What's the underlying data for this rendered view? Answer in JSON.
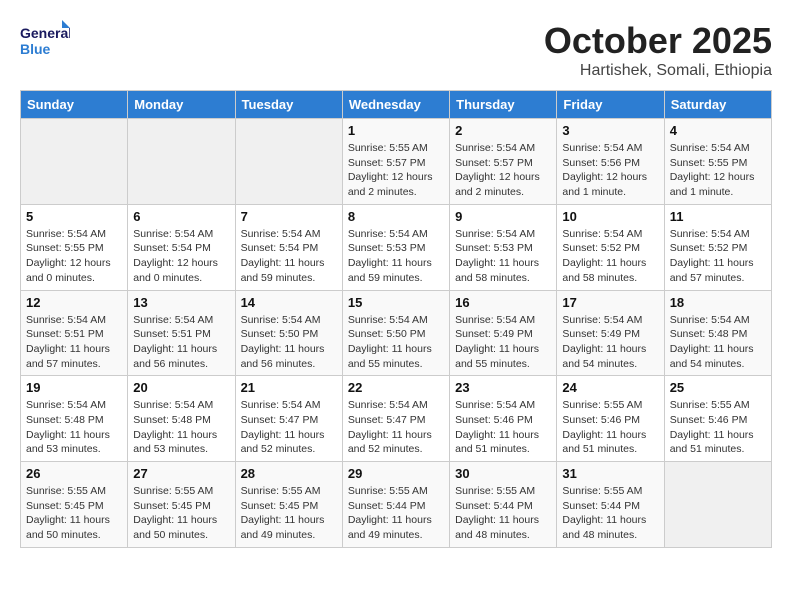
{
  "header": {
    "logo_line1": "General",
    "logo_line2": "Blue",
    "month": "October 2025",
    "location": "Hartishek, Somali, Ethiopia"
  },
  "weekdays": [
    "Sunday",
    "Monday",
    "Tuesday",
    "Wednesday",
    "Thursday",
    "Friday",
    "Saturday"
  ],
  "weeks": [
    [
      {
        "day": "",
        "info": ""
      },
      {
        "day": "",
        "info": ""
      },
      {
        "day": "",
        "info": ""
      },
      {
        "day": "1",
        "info": "Sunrise: 5:55 AM\nSunset: 5:57 PM\nDaylight: 12 hours\nand 2 minutes."
      },
      {
        "day": "2",
        "info": "Sunrise: 5:54 AM\nSunset: 5:57 PM\nDaylight: 12 hours\nand 2 minutes."
      },
      {
        "day": "3",
        "info": "Sunrise: 5:54 AM\nSunset: 5:56 PM\nDaylight: 12 hours\nand 1 minute."
      },
      {
        "day": "4",
        "info": "Sunrise: 5:54 AM\nSunset: 5:55 PM\nDaylight: 12 hours\nand 1 minute."
      }
    ],
    [
      {
        "day": "5",
        "info": "Sunrise: 5:54 AM\nSunset: 5:55 PM\nDaylight: 12 hours\nand 0 minutes."
      },
      {
        "day": "6",
        "info": "Sunrise: 5:54 AM\nSunset: 5:54 PM\nDaylight: 12 hours\nand 0 minutes."
      },
      {
        "day": "7",
        "info": "Sunrise: 5:54 AM\nSunset: 5:54 PM\nDaylight: 11 hours\nand 59 minutes."
      },
      {
        "day": "8",
        "info": "Sunrise: 5:54 AM\nSunset: 5:53 PM\nDaylight: 11 hours\nand 59 minutes."
      },
      {
        "day": "9",
        "info": "Sunrise: 5:54 AM\nSunset: 5:53 PM\nDaylight: 11 hours\nand 58 minutes."
      },
      {
        "day": "10",
        "info": "Sunrise: 5:54 AM\nSunset: 5:52 PM\nDaylight: 11 hours\nand 58 minutes."
      },
      {
        "day": "11",
        "info": "Sunrise: 5:54 AM\nSunset: 5:52 PM\nDaylight: 11 hours\nand 57 minutes."
      }
    ],
    [
      {
        "day": "12",
        "info": "Sunrise: 5:54 AM\nSunset: 5:51 PM\nDaylight: 11 hours\nand 57 minutes."
      },
      {
        "day": "13",
        "info": "Sunrise: 5:54 AM\nSunset: 5:51 PM\nDaylight: 11 hours\nand 56 minutes."
      },
      {
        "day": "14",
        "info": "Sunrise: 5:54 AM\nSunset: 5:50 PM\nDaylight: 11 hours\nand 56 minutes."
      },
      {
        "day": "15",
        "info": "Sunrise: 5:54 AM\nSunset: 5:50 PM\nDaylight: 11 hours\nand 55 minutes."
      },
      {
        "day": "16",
        "info": "Sunrise: 5:54 AM\nSunset: 5:49 PM\nDaylight: 11 hours\nand 55 minutes."
      },
      {
        "day": "17",
        "info": "Sunrise: 5:54 AM\nSunset: 5:49 PM\nDaylight: 11 hours\nand 54 minutes."
      },
      {
        "day": "18",
        "info": "Sunrise: 5:54 AM\nSunset: 5:48 PM\nDaylight: 11 hours\nand 54 minutes."
      }
    ],
    [
      {
        "day": "19",
        "info": "Sunrise: 5:54 AM\nSunset: 5:48 PM\nDaylight: 11 hours\nand 53 minutes."
      },
      {
        "day": "20",
        "info": "Sunrise: 5:54 AM\nSunset: 5:48 PM\nDaylight: 11 hours\nand 53 minutes."
      },
      {
        "day": "21",
        "info": "Sunrise: 5:54 AM\nSunset: 5:47 PM\nDaylight: 11 hours\nand 52 minutes."
      },
      {
        "day": "22",
        "info": "Sunrise: 5:54 AM\nSunset: 5:47 PM\nDaylight: 11 hours\nand 52 minutes."
      },
      {
        "day": "23",
        "info": "Sunrise: 5:54 AM\nSunset: 5:46 PM\nDaylight: 11 hours\nand 51 minutes."
      },
      {
        "day": "24",
        "info": "Sunrise: 5:55 AM\nSunset: 5:46 PM\nDaylight: 11 hours\nand 51 minutes."
      },
      {
        "day": "25",
        "info": "Sunrise: 5:55 AM\nSunset: 5:46 PM\nDaylight: 11 hours\nand 51 minutes."
      }
    ],
    [
      {
        "day": "26",
        "info": "Sunrise: 5:55 AM\nSunset: 5:45 PM\nDaylight: 11 hours\nand 50 minutes."
      },
      {
        "day": "27",
        "info": "Sunrise: 5:55 AM\nSunset: 5:45 PM\nDaylight: 11 hours\nand 50 minutes."
      },
      {
        "day": "28",
        "info": "Sunrise: 5:55 AM\nSunset: 5:45 PM\nDaylight: 11 hours\nand 49 minutes."
      },
      {
        "day": "29",
        "info": "Sunrise: 5:55 AM\nSunset: 5:44 PM\nDaylight: 11 hours\nand 49 minutes."
      },
      {
        "day": "30",
        "info": "Sunrise: 5:55 AM\nSunset: 5:44 PM\nDaylight: 11 hours\nand 48 minutes."
      },
      {
        "day": "31",
        "info": "Sunrise: 5:55 AM\nSunset: 5:44 PM\nDaylight: 11 hours\nand 48 minutes."
      },
      {
        "day": "",
        "info": ""
      }
    ]
  ]
}
